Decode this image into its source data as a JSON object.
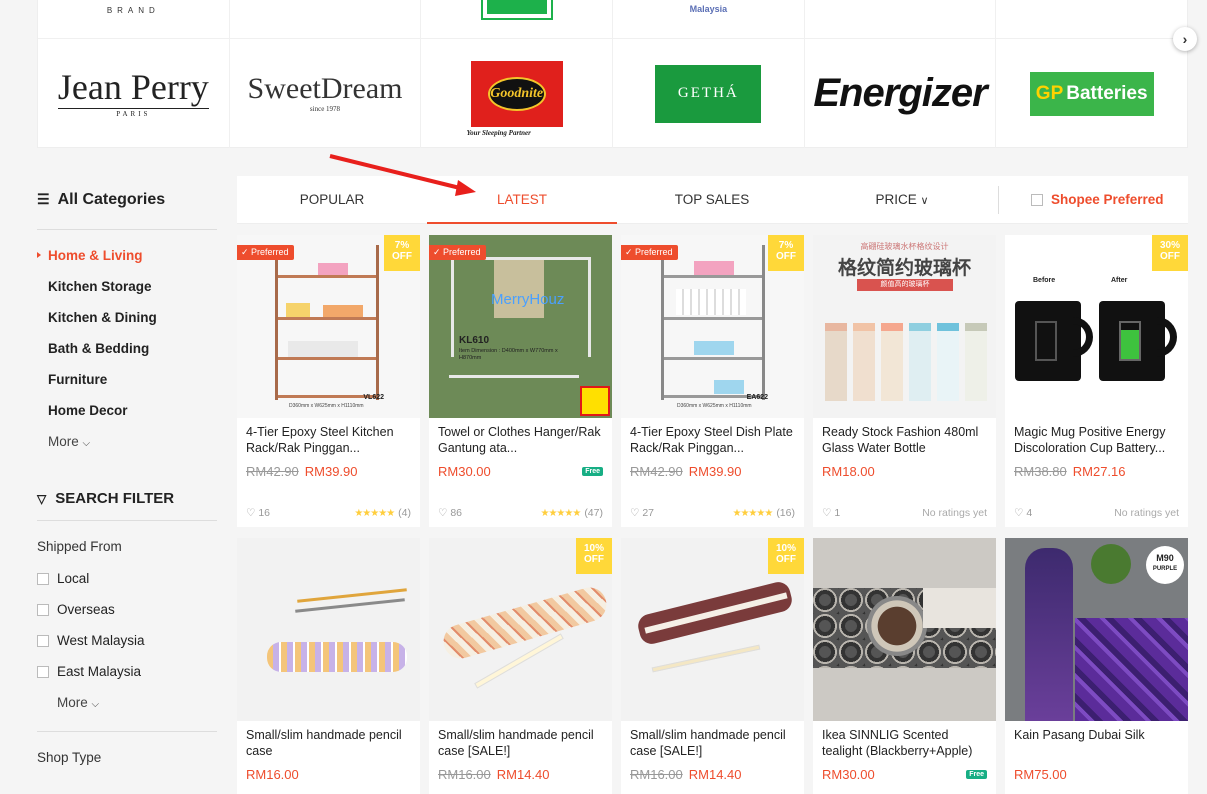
{
  "brands_top": [
    {
      "text": "BRAND"
    },
    {
      "text": ""
    },
    {
      "text": ""
    },
    {
      "text": "Malaysia"
    },
    {
      "text": ""
    },
    {
      "text": ""
    }
  ],
  "brands": [
    {
      "name": "Jean Perry",
      "sub": "PARIS"
    },
    {
      "name": "SweetDream",
      "sub": "since 1978"
    },
    {
      "name": "Goodnite",
      "sub": "Your Sleeping Partner"
    },
    {
      "name": "GETHÁ"
    },
    {
      "name": "Energizer"
    },
    {
      "name": "Batteries",
      "prefix": "GP"
    }
  ],
  "next_icon": "chevron-right-icon",
  "sidebar": {
    "all_categories": "All Categories",
    "categories": [
      {
        "label": "Home & Living",
        "active": true
      },
      {
        "label": "Kitchen Storage"
      },
      {
        "label": "Kitchen & Dining"
      },
      {
        "label": "Bath & Bedding"
      },
      {
        "label": "Furniture"
      },
      {
        "label": "Home Decor"
      }
    ],
    "more_label": "More",
    "search_filter": "SEARCH FILTER",
    "shipped_from": "Shipped From",
    "ship_options": [
      "Local",
      "Overseas",
      "West Malaysia",
      "East Malaysia"
    ],
    "more2_label": "More",
    "shop_type": "Shop Type"
  },
  "sortbar": {
    "tabs": [
      "POPULAR",
      "LATEST",
      "TOP SALES",
      "PRICE"
    ],
    "active": "LATEST",
    "preferred": "Shopee Preferred"
  },
  "colors": {
    "accent": "#ee4d2d",
    "badge_yellow": "#ffd839",
    "star": "#ffce3d",
    "free_ship": "#17ae84"
  },
  "products": [
    {
      "name": "4-Tier Epoxy Steel Kitchen Rack/Rak Pinggan...",
      "old_price": "RM42.90",
      "price": "RM39.90",
      "preferred": "Preferred",
      "discount": "7%",
      "off": "OFF",
      "likes": "16",
      "stars": "★★★★★",
      "ratings": "(4)",
      "model": "VL622",
      "dims": "D360mm x W625mm x H1110mm"
    },
    {
      "name": "Towel or Clothes Hanger/Rak Gantung ata...",
      "price": "RM30.00",
      "preferred": "Preferred",
      "free": "Free",
      "likes": "86",
      "stars": "★★★★★",
      "ratings": "(47)",
      "brand": "MerryHouz",
      "model": "KL610",
      "dims": "Item Dimension : D400mm x W770mm x H870mm"
    },
    {
      "name": "4-Tier Epoxy Steel Dish Plate Rack/Rak Pinggan...",
      "old_price": "RM42.90",
      "price": "RM39.90",
      "preferred": "Preferred",
      "discount": "7%",
      "off": "OFF",
      "likes": "27",
      "stars": "★★★★★",
      "ratings": "(16)",
      "model": "EA622",
      "dims": "D360mm x W625mm x H1110mm"
    },
    {
      "name": "Ready Stock Fashion 480ml Glass Water Bottle",
      "price": "RM18.00",
      "likes": "1",
      "noratings": "No ratings yet",
      "cn_top": "高硼硅玻璃水杯格纹设计",
      "cn_title": "格纹简约玻璃杯",
      "cn_sub": "颜值高的玻璃杯"
    },
    {
      "name": "Magic Mug Positive Energy Discoloration Cup Battery...",
      "old_price": "RM38.80",
      "price": "RM27.16",
      "discount": "30%",
      "off": "OFF",
      "likes": "4",
      "noratings": "No ratings yet",
      "before": "Before",
      "after": "After"
    },
    {
      "name": "Small/slim handmade pencil case",
      "price": "RM16.00"
    },
    {
      "name": "Small/slim handmade pencil case [SALE!]",
      "old_price": "RM16.00",
      "price": "RM14.40",
      "discount": "10%",
      "off": "OFF"
    },
    {
      "name": "Small/slim handmade pencil case [SALE!]",
      "old_price": "RM16.00",
      "price": "RM14.40",
      "discount": "10%",
      "off": "OFF"
    },
    {
      "name": "Ikea SINNLIG Scented tealight (Blackberry+Apple)",
      "price": "RM30.00",
      "free": "Free"
    },
    {
      "name": "Kain Pasang Dubai Silk",
      "price": "RM75.00",
      "badge": "M90",
      "badge_sub": "PURPLE"
    }
  ]
}
